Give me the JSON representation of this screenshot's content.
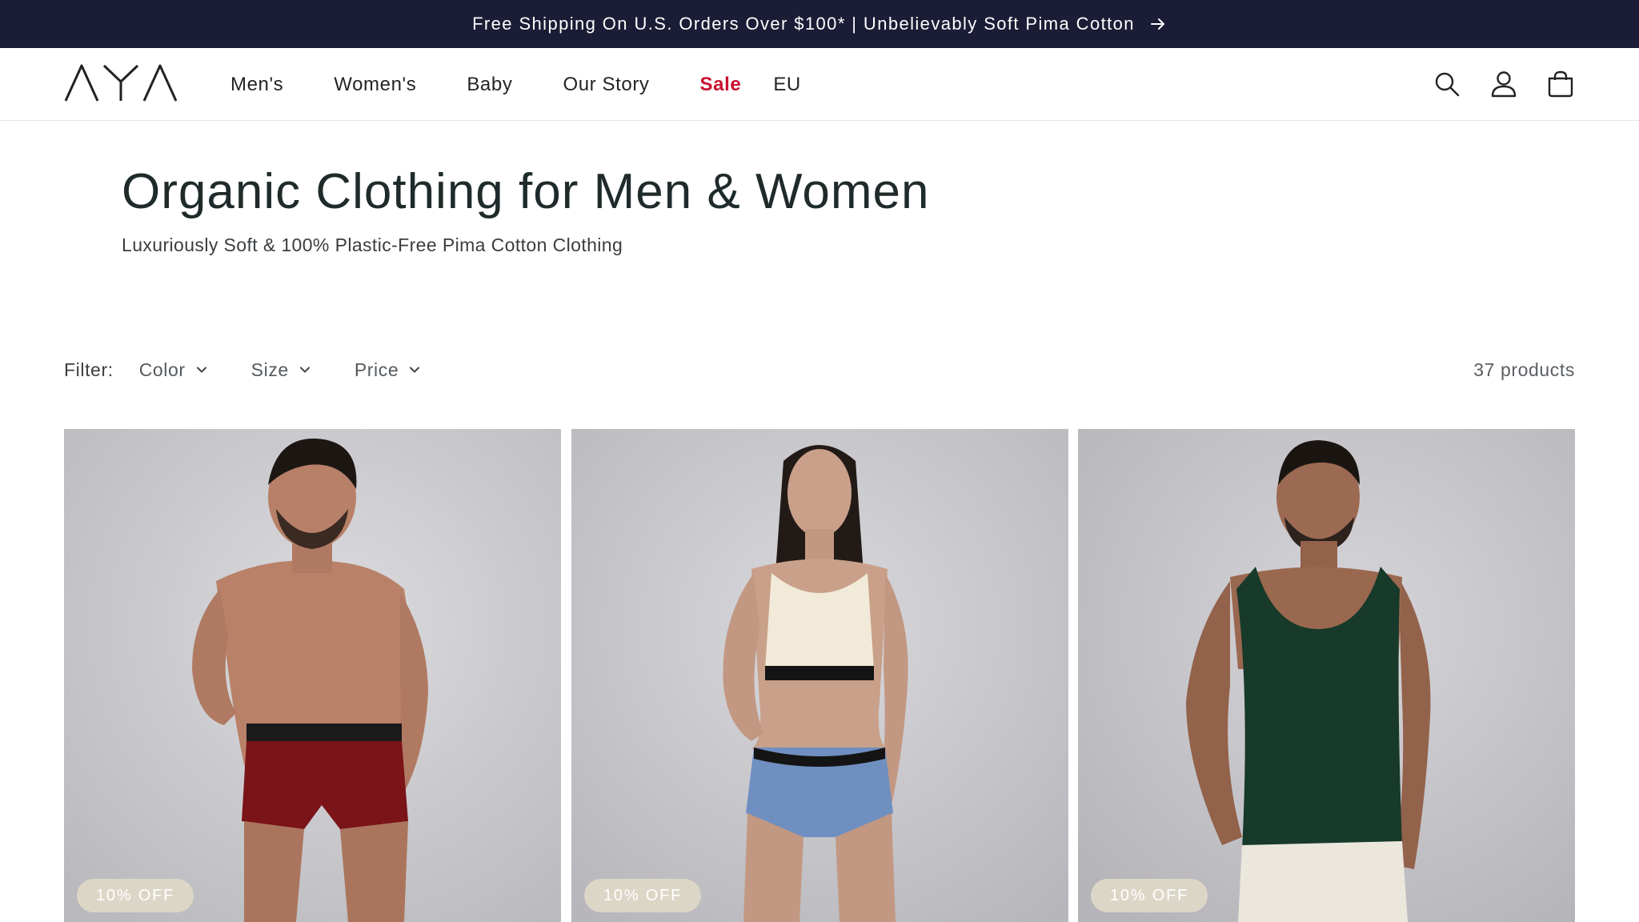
{
  "announcement": {
    "text": "Free Shipping On U.S. Orders Over $100* | Unbelievably Soft Pima Cotton",
    "icon": "arrow-right-icon"
  },
  "header": {
    "logo_text": "AYA",
    "nav": [
      {
        "label": "Men's"
      },
      {
        "label": "Women's"
      },
      {
        "label": "Baby"
      },
      {
        "label": "Our Story"
      },
      {
        "label": "Sale",
        "color": "#c8102e"
      },
      {
        "label": "EU"
      }
    ],
    "icons": [
      "search-icon",
      "account-icon",
      "cart-icon"
    ]
  },
  "hero": {
    "title": "Organic Clothing for Men & Women",
    "subtitle": "Luxuriously Soft & 100% Plastic-Free Pima Cotton Clothing"
  },
  "filters": {
    "label": "Filter:",
    "options": [
      "Color",
      "Size",
      "Price"
    ],
    "count": "37 products"
  },
  "products": [
    {
      "badge": "10% OFF",
      "garment": "boxer briefs",
      "garment_color": "#7a1418"
    },
    {
      "badge": "10% OFF",
      "garment": "bralette and shorts",
      "garment_color": "#6f8fc0"
    },
    {
      "badge": "10% OFF",
      "garment": "tank top",
      "garment_color": "#173a2a"
    }
  ],
  "colors": {
    "announcement_bg": "#1b1c35",
    "sale": "#c8102e",
    "badge_bg": "#dcd6c7",
    "photo_bg": "#cfcfd3"
  }
}
